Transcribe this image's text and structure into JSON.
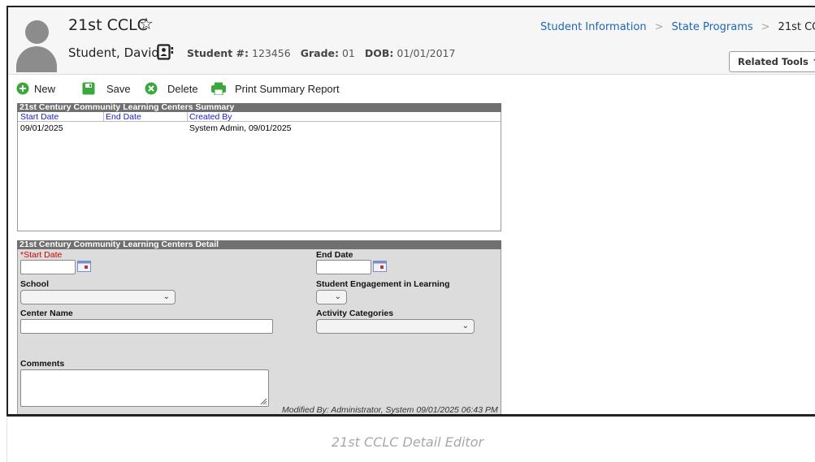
{
  "header": {
    "page_title": "21st CCLC",
    "student_name": "Student, David",
    "student_number_label": "Student #:",
    "student_number": "123456",
    "grade_label": "Grade:",
    "grade": "01",
    "dob_label": "DOB:",
    "dob": "01/01/2017",
    "related_tools_label": "Related Tools",
    "icons": [
      "avatar",
      "star-icon",
      "contact-card-icon",
      "chevron-up-icon"
    ]
  },
  "breadcrumb": {
    "items": [
      "Student Information",
      "State Programs",
      "21st CCLC"
    ]
  },
  "toolbar": {
    "new_label": "New",
    "save_label": "Save",
    "delete_label": "Delete",
    "print_label": "Print Summary Report"
  },
  "summary": {
    "title": "21st Century Community Learning Centers Summary",
    "columns": [
      "Start Date",
      "End Date",
      "Created By"
    ],
    "rows": [
      {
        "start_date": "09/01/2025",
        "end_date": "",
        "created_by": "System Admin, 09/01/2025"
      }
    ]
  },
  "detail": {
    "title": "21st Century Community Learning Centers Detail",
    "start_date_label": "*Start Date",
    "start_date_value": "",
    "end_date_label": "End Date",
    "end_date_value": "",
    "school_label": "School",
    "school_value": "",
    "engagement_label": "Student Engagement in Learning",
    "engagement_value": "",
    "center_name_label": "Center Name",
    "center_name_value": "",
    "activity_label": "Activity Categories",
    "activity_value": "",
    "comments_label": "Comments",
    "comments_value": "",
    "modified_by": "Modified By: Administrator, System 09/01/2025 06:43 PM"
  },
  "caption": "21st CCLC Detail Editor",
  "colors": {
    "link_blue": "#1a67b5",
    "panel_header": "#707070",
    "detail_bg": "#dcdcdc",
    "toolbar_green": "#3aa83a",
    "required_red": "#d40000",
    "column_header_blue": "#1a1ad0"
  }
}
